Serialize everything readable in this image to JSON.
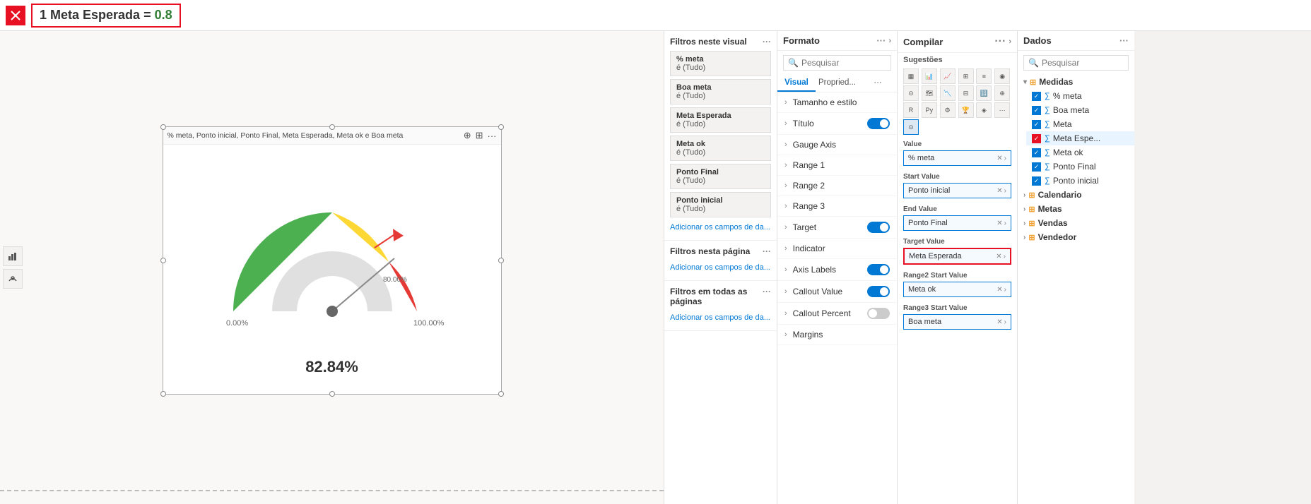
{
  "topbar": {
    "formula": "1 Meta Esperada = 0.8",
    "formula_prefix": "1 Meta Esperada = ",
    "formula_value": "0.8"
  },
  "visual": {
    "title": "% meta, Ponto inicial, Ponto Final, Meta Esperada, Meta ok e Boa meta",
    "gauge_percent": "82.84%",
    "axis_min": "0.00%",
    "axis_max": "100.00%",
    "axis_marker": "80.00%"
  },
  "filters": {
    "header": "Filtros neste visual",
    "header2": "Filtros nesta página",
    "header3": "Filtros em todas as páginas",
    "dots": "···",
    "items": [
      {
        "name": "% meta",
        "value": "é (Tudo)"
      },
      {
        "name": "Boa meta",
        "value": "é (Tudo)"
      },
      {
        "name": "Meta Esperada",
        "value": "é (Tudo)"
      },
      {
        "name": "Meta ok",
        "value": "é (Tudo)"
      },
      {
        "name": "Ponto Final",
        "value": "é (Tudo)"
      },
      {
        "name": "Ponto inicial",
        "value": "é (Tudo)"
      }
    ],
    "add_fields": "Adicionar os campos de da...",
    "add_fields2": "Adicionar os campos de da...",
    "add_fields3": "Adicionar os campos de da..."
  },
  "format": {
    "header": "Formato",
    "dots": "···",
    "search_placeholder": "Pesquisar",
    "tab_visual": "Visual",
    "tab_properties": "Propried...",
    "tab_more": "···",
    "menu_items": [
      {
        "label": "Tamanho e estilo",
        "toggle": null
      },
      {
        "label": "Título",
        "toggle": "on"
      },
      {
        "label": "Gauge Axis",
        "toggle": null
      },
      {
        "label": "Range 1",
        "toggle": null
      },
      {
        "label": "Range 2",
        "toggle": null
      },
      {
        "label": "Range 3",
        "toggle": null
      },
      {
        "label": "Target",
        "toggle": "on"
      },
      {
        "label": "Indicator",
        "toggle": null
      },
      {
        "label": "Axis Labels",
        "toggle": "on"
      },
      {
        "label": "Callout Value",
        "toggle": "on"
      },
      {
        "label": "Callout Percent",
        "toggle": "off"
      },
      {
        "label": "Margins",
        "toggle": null
      }
    ]
  },
  "build": {
    "header": "Compilar",
    "dots": "···",
    "suggestions_label": "Sugestões",
    "fields": [
      {
        "label": "Value",
        "value": "% meta",
        "highlighted": false
      },
      {
        "label": "Start Value",
        "value": "Ponto inicial",
        "highlighted": false
      },
      {
        "label": "End Value",
        "value": "Ponto Final",
        "highlighted": false
      },
      {
        "label": "Target Value",
        "value": "Meta Esperada",
        "highlighted": true
      },
      {
        "label": "Range2 Start Value",
        "value": "Meta ok",
        "highlighted": false
      },
      {
        "label": "Range3 Start Value",
        "value": "Boa meta",
        "highlighted": false
      }
    ]
  },
  "data": {
    "header": "Dados",
    "dots": "···",
    "search_placeholder": "Pesquisar",
    "groups": [
      {
        "name": "Medidas",
        "icon": "table",
        "expanded": true,
        "items": [
          {
            "name": "% meta",
            "checked": true,
            "selected": false
          },
          {
            "name": "Boa meta",
            "checked": true,
            "selected": false
          },
          {
            "name": "Meta",
            "checked": true,
            "selected": false
          },
          {
            "name": "Meta Espe...",
            "checked": true,
            "selected": true
          },
          {
            "name": "Meta ok",
            "checked": true,
            "selected": false
          },
          {
            "name": "Ponto Final",
            "checked": true,
            "selected": false
          },
          {
            "name": "Ponto inicial",
            "checked": true,
            "selected": false
          }
        ]
      },
      {
        "name": "Calendario",
        "icon": "table",
        "expanded": false,
        "items": []
      },
      {
        "name": "Metas",
        "icon": "table",
        "expanded": false,
        "items": []
      },
      {
        "name": "Vendas",
        "icon": "table",
        "expanded": false,
        "items": []
      },
      {
        "name": "Vendedor",
        "icon": "table",
        "expanded": false,
        "items": []
      }
    ]
  }
}
